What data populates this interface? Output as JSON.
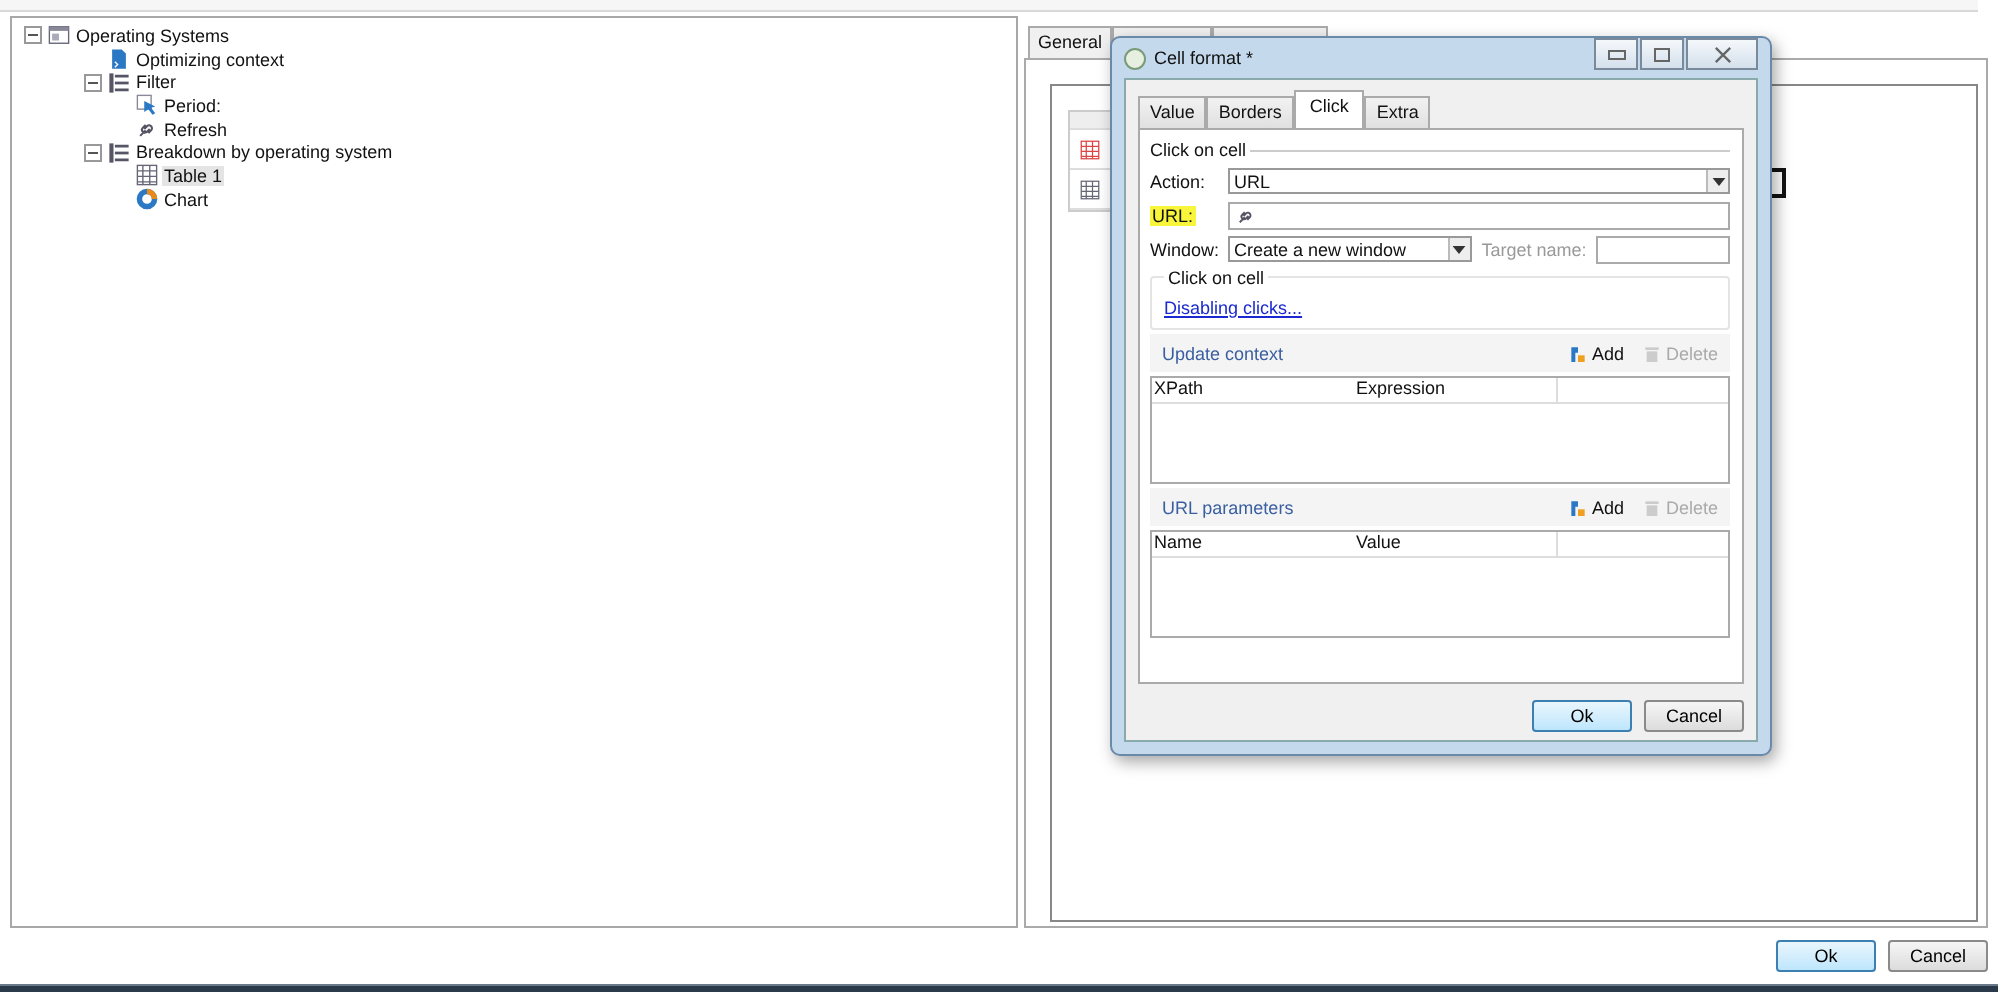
{
  "tree": [
    {
      "label": "Operating Systems",
      "kind": "report",
      "expanded": true,
      "selected": false,
      "children": [
        {
          "label": "Optimizing context",
          "kind": "script",
          "selected": false
        },
        {
          "label": "Filter",
          "kind": "list",
          "expanded": true,
          "selected": false,
          "children": [
            {
              "label": "Period:",
              "kind": "cursor",
              "selected": false
            },
            {
              "label": "Refresh",
              "kind": "link",
              "selected": false
            }
          ]
        },
        {
          "label": "Breakdown by operating system",
          "kind": "list",
          "expanded": true,
          "selected": false,
          "children": [
            {
              "label": "Table 1",
              "kind": "table",
              "selected": true
            },
            {
              "label": "Chart",
              "kind": "chart",
              "selected": false
            }
          ]
        }
      ]
    }
  ],
  "properties": {
    "tabs": [
      {
        "label": "General",
        "selected": false
      }
    ],
    "buttons": [
      "Ok",
      "Cancel"
    ]
  },
  "dialog": {
    "title": "Cell format *",
    "tabs": [
      {
        "label": "Value",
        "selected": false
      },
      {
        "label": "Borders",
        "selected": false
      },
      {
        "label": "Click",
        "selected": true
      },
      {
        "label": "Extra",
        "selected": false
      }
    ],
    "section": "Click on cell",
    "action": {
      "label": "Action:",
      "value": "URL"
    },
    "url": {
      "label": "URL:",
      "highlighted": true
    },
    "window": {
      "label": "Window:",
      "value": "Create a new window"
    },
    "target": {
      "label": "Target name:",
      "disabled": true
    },
    "group": {
      "title": "Click on cell",
      "link": "Disabling clicks..."
    },
    "lists": [
      {
        "title": "Update context",
        "add": "Add",
        "delete": "Delete",
        "delete_disabled": true,
        "columns": [
          "XPath",
          "Expression"
        ]
      },
      {
        "title": "URL parameters",
        "add": "Add",
        "delete": "Delete",
        "delete_disabled": true,
        "columns": [
          "Name",
          "Value"
        ]
      }
    ],
    "buttons": [
      "Ok",
      "Cancel"
    ]
  }
}
